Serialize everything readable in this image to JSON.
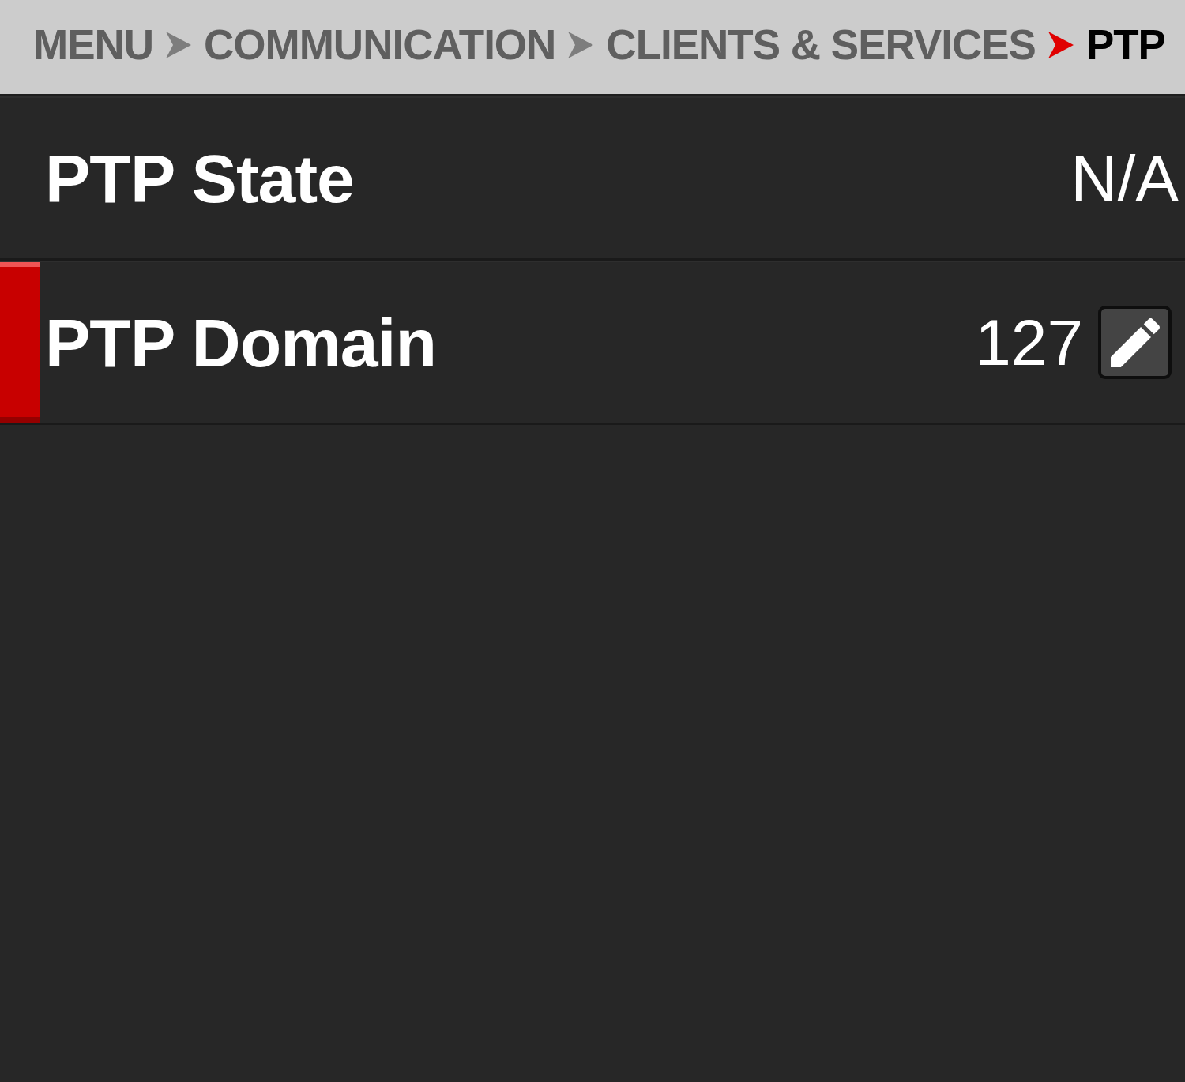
{
  "breadcrumb": [
    {
      "label": "MENU",
      "current": false
    },
    {
      "label": "COMMUNICATION",
      "current": false
    },
    {
      "label": "CLIENTS & SERVICES",
      "current": false
    },
    {
      "label": "PTP",
      "current": true
    }
  ],
  "rows": [
    {
      "kind": "readonly",
      "label": "PTP State",
      "value": "N/A",
      "selected": false
    },
    {
      "kind": "editable",
      "label": "PTP Domain",
      "value": "127",
      "selected": true
    }
  ]
}
